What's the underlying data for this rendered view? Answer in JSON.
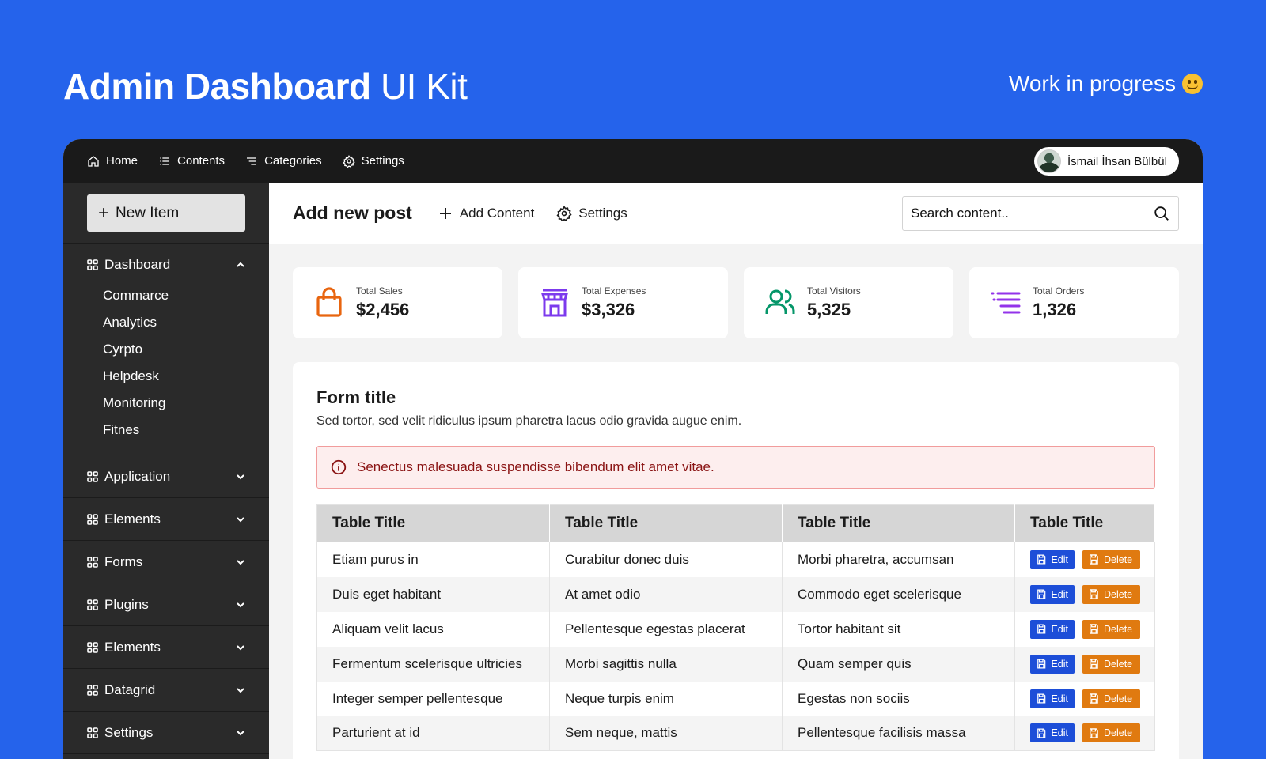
{
  "hero": {
    "title_bold": "Admin Dashboard",
    "title_light": "UI Kit",
    "status": "Work in progress"
  },
  "topnav": {
    "items": [
      {
        "label": "Home",
        "icon": "home-icon"
      },
      {
        "label": "Contents",
        "icon": "list-icon"
      },
      {
        "label": "Categories",
        "icon": "categories-icon"
      },
      {
        "label": "Settings",
        "icon": "gear-icon"
      }
    ],
    "user_name": "İsmail İhsan Bülbül"
  },
  "sidebar": {
    "new_item_label": "New Item",
    "sections": [
      {
        "label": "Dashboard",
        "expanded": true,
        "children": [
          "Commarce",
          "Analytics",
          "Cyrpto",
          "Helpdesk",
          "Monitoring",
          "Fitnes"
        ]
      },
      {
        "label": "Application",
        "expanded": false
      },
      {
        "label": "Elements",
        "expanded": false
      },
      {
        "label": "Forms",
        "expanded": false
      },
      {
        "label": "Plugins",
        "expanded": false
      },
      {
        "label": "Elements",
        "expanded": false
      },
      {
        "label": "Datagrid",
        "expanded": false
      },
      {
        "label": "Settings",
        "expanded": false
      }
    ]
  },
  "toolbar": {
    "title": "Add new post",
    "add_content_label": "Add Content",
    "settings_label": "Settings",
    "search_placeholder": "Search content.."
  },
  "stats": [
    {
      "label": "Total Sales",
      "value": "$2,456",
      "icon": "shopping-bag-icon",
      "color": "#E8650F"
    },
    {
      "label": "Total Expenses",
      "value": "$3,326",
      "icon": "store-icon",
      "color": "#7C3AED"
    },
    {
      "label": "Total Visitors",
      "value": "5,325",
      "icon": "users-icon",
      "color": "#059669"
    },
    {
      "label": "Total Orders",
      "value": "1,326",
      "icon": "orders-list-icon",
      "color": "#9333EA"
    }
  ],
  "form": {
    "title": "Form title",
    "description": "Sed tortor, sed velit ridiculus ipsum pharetra lacus odio gravida augue enim.",
    "alert": "Senectus malesuada suspendisse bibendum elit amet vitae."
  },
  "table": {
    "headers": [
      "Table Title",
      "Table Title",
      "Table Title",
      "Table Title"
    ],
    "edit_label": "Edit",
    "delete_label": "Delete",
    "rows": [
      [
        "Etiam purus in",
        "Curabitur donec duis",
        "Morbi pharetra, accumsan"
      ],
      [
        "Duis eget habitant",
        "At amet odio",
        "Commodo eget scelerisque"
      ],
      [
        "Aliquam velit lacus",
        "Pellentesque egestas placerat",
        "Tortor habitant sit"
      ],
      [
        "Fermentum scelerisque ultricies",
        "Morbi sagittis nulla",
        "Quam semper quis"
      ],
      [
        "Integer semper pellentesque",
        "Neque turpis enim",
        "Egestas non sociis"
      ],
      [
        "Parturient at id",
        "Sem neque, mattis",
        "Pellentesque facilisis massa"
      ]
    ]
  },
  "colors": {
    "background": "#2563EB",
    "edit_button": "#1D4ED8",
    "delete_button": "#E07A10",
    "alert_text": "#8A1313"
  }
}
